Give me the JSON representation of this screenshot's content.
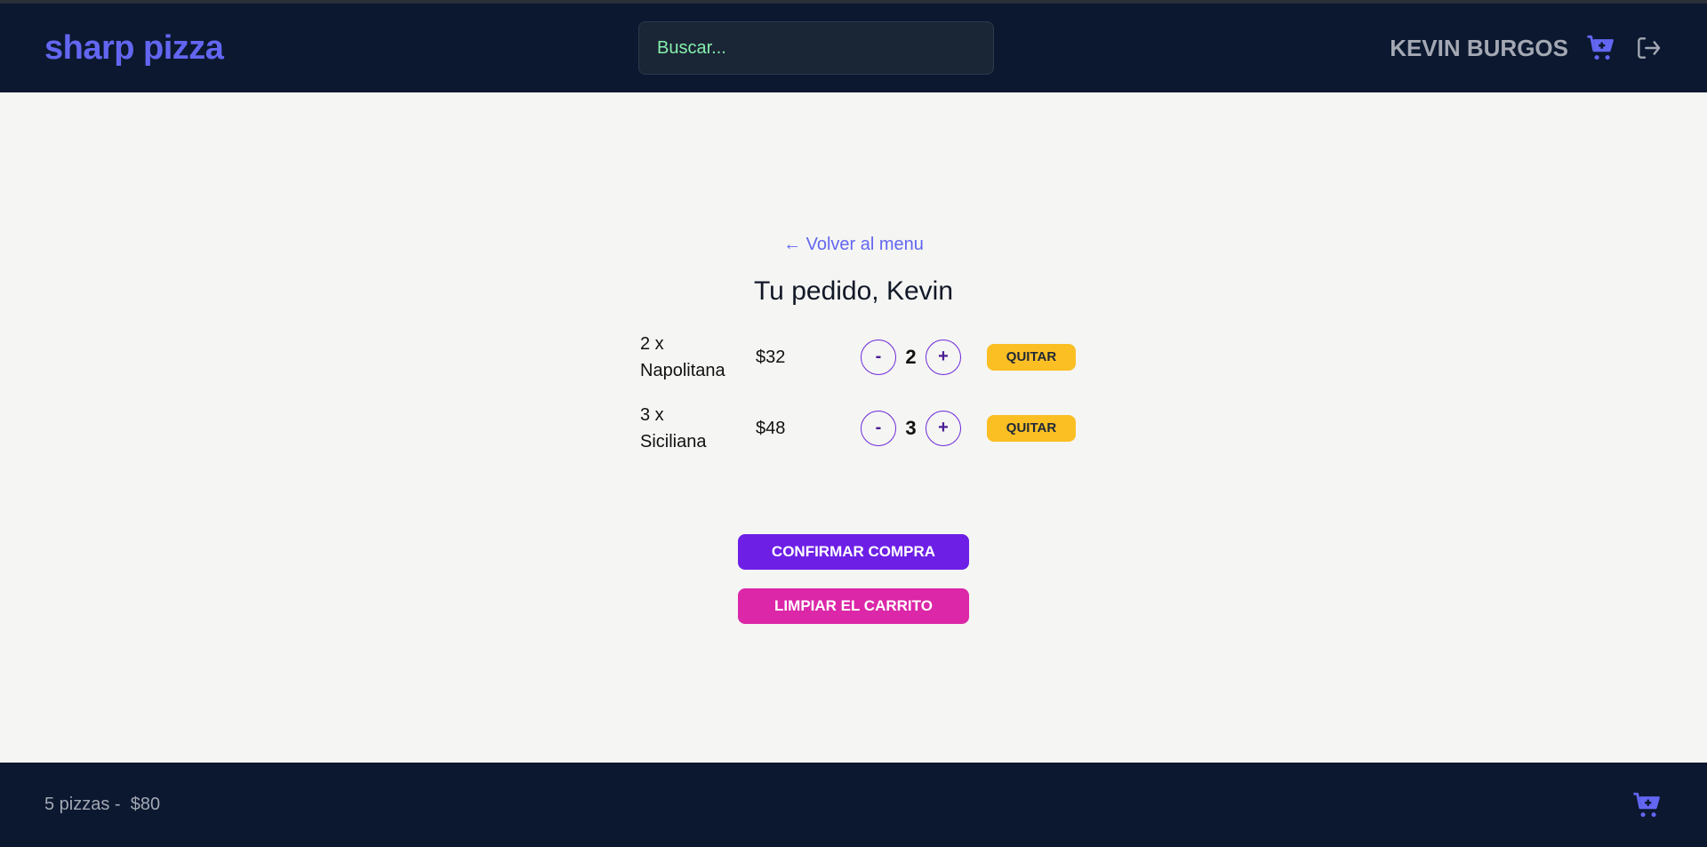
{
  "header": {
    "logo": "sharp pizza",
    "search_placeholder": "Buscar...",
    "username": "KEVIN BURGOS",
    "cart_icon": "cart-plus-icon",
    "logout_icon": "logout-icon"
  },
  "main": {
    "back_link": "← Volver al menu",
    "title": "Tu pedido, Kevin",
    "items": [
      {
        "qty_label": "2 x",
        "name": "Napolitana",
        "price": "$32",
        "quantity": "2",
        "minus": "-",
        "plus": "+",
        "remove": "QUITAR"
      },
      {
        "qty_label": "3 x",
        "name": "Siciliana",
        "price": "$48",
        "quantity": "3",
        "minus": "-",
        "plus": "+",
        "remove": "QUITAR"
      }
    ],
    "confirm_button": "CONFIRMAR COMPRA",
    "clear_button": "LIMPIAR EL CARRITO"
  },
  "footer": {
    "summary": "5 pizzas -  $80",
    "cart_icon": "cart-plus-icon"
  },
  "colors": {
    "nav_bg": "#0b1830",
    "accent": "#6366f1",
    "confirm": "#6d1fe6",
    "clear": "#db27a8",
    "remove": "#fbbf24"
  }
}
